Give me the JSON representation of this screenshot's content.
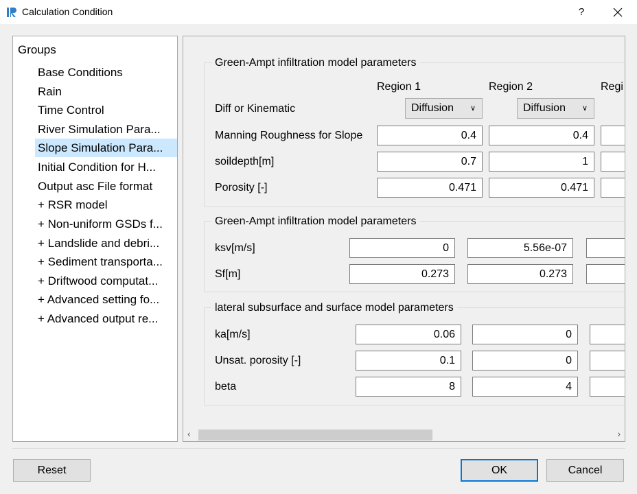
{
  "window": {
    "title": "Calculation Condition",
    "help_label": "?"
  },
  "groups": {
    "header": "Groups",
    "items": [
      "Base Conditions",
      "Rain",
      "Time Control",
      "River Simulation Para...",
      "Slope Simulation Para...",
      "Initial Condition for H...",
      "Output asc File format",
      "+ RSR model",
      "+ Non-uniform GSDs f...",
      "+ Landslide and debri...",
      "+ Sediment transporta...",
      "+ Driftwood computat...",
      "+ Advanced setting fo...",
      "+ Advanced output re..."
    ],
    "selected_index": 4
  },
  "section1": {
    "title": "Green-Ampt infiltration model parameters",
    "region_headers": [
      "Region 1",
      "Region 2",
      "Regi"
    ],
    "rows": {
      "diff": {
        "label": "Diff or Kinematic",
        "values": [
          "Diffusion",
          "Diffusion"
        ]
      },
      "manning": {
        "label": "Manning Roughness for Slope",
        "values": [
          "0.4",
          "0.4"
        ]
      },
      "soildepth": {
        "label": "soildepth[m]",
        "values": [
          "0.7",
          "1"
        ]
      },
      "porosity": {
        "label": "Porosity [-]",
        "values": [
          "0.471",
          "0.471"
        ]
      }
    }
  },
  "section2": {
    "title": "Green-Ampt infiltration model parameters",
    "rows": {
      "ksv": {
        "label": "ksv[m/s]",
        "values": [
          "0",
          "5.56e-07"
        ]
      },
      "sf": {
        "label": "Sf[m]",
        "values": [
          "0.273",
          "0.273"
        ]
      }
    }
  },
  "section3": {
    "title": "lateral subsurface and surface model parameters",
    "rows": {
      "ka": {
        "label": "ka[m/s]",
        "values": [
          "0.06",
          "0"
        ]
      },
      "unsat": {
        "label": "Unsat. porosity [-]",
        "values": [
          "0.1",
          "0"
        ]
      },
      "beta": {
        "label": "beta",
        "values": [
          "8",
          "4"
        ]
      }
    }
  },
  "buttons": {
    "reset": "Reset",
    "ok": "OK",
    "cancel": "Cancel"
  },
  "icons": {
    "app": "ir-app-icon",
    "close": "close-icon",
    "dropdown": "chevron-down-icon",
    "scroll_left": "scroll-left-arrow-icon",
    "scroll_right": "scroll-right-arrow-icon"
  },
  "colors": {
    "selection": "#cce8ff",
    "default_button_border": "#0078d7"
  }
}
